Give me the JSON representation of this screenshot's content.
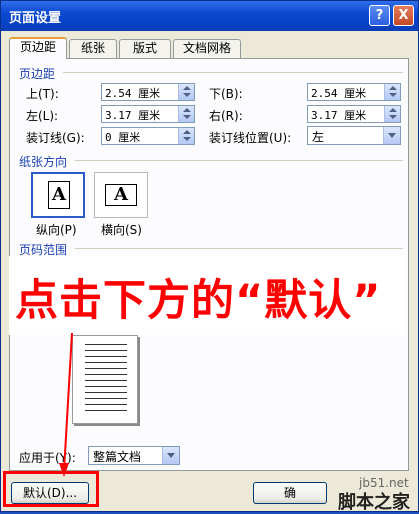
{
  "window": {
    "title": "页面设置",
    "help_label": "?",
    "close_label": "X"
  },
  "tabs": [
    {
      "label": "页边距",
      "active": true
    },
    {
      "label": "纸张"
    },
    {
      "label": "版式"
    },
    {
      "label": "文档网格"
    }
  ],
  "margins": {
    "section_title": "页边距",
    "top_label": "上(T):",
    "top_value": "2.54 厘米",
    "bottom_label": "下(B):",
    "bottom_value": "2.54 厘米",
    "left_label": "左(L):",
    "left_value": "3.17 厘米",
    "right_label": "右(R):",
    "right_value": "3.17 厘米",
    "gutter_label": "装订线(G):",
    "gutter_value": "0 厘米",
    "gutter_pos_label": "装订线位置(U):",
    "gutter_pos_value": "左"
  },
  "orientation": {
    "section_title": "纸张方向",
    "portrait_label": "纵向(P)",
    "landscape_label": "横向(S)",
    "icon_glyph": "A"
  },
  "pages": {
    "section_title": "页码范围"
  },
  "banner": {
    "text": "点击下方的“默认”",
    "color": "#ff0000"
  },
  "apply": {
    "label": "应用于(Y):",
    "value": "整篇文档"
  },
  "buttons": {
    "default_label": "默认(D)...",
    "ok_label": "确"
  },
  "watermark": {
    "site": "jb51.net",
    "brand": "脚本之家"
  }
}
